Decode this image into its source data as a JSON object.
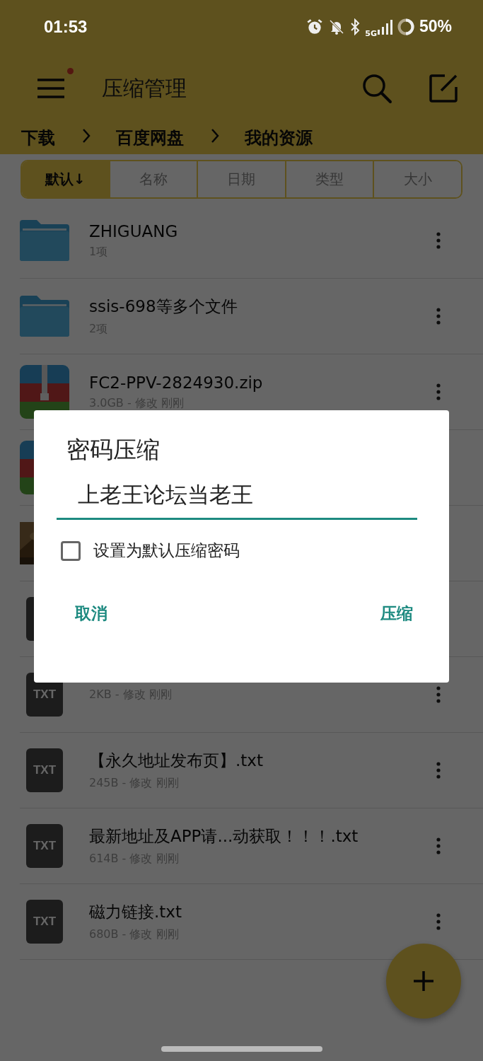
{
  "status_bar": {
    "time": "01:53",
    "network": "5G",
    "battery": "50%"
  },
  "toolbar": {
    "title": "压缩管理",
    "menu_badge": true
  },
  "breadcrumb": [
    "下载",
    "百度网盘",
    "我的资源"
  ],
  "sort_tabs": [
    {
      "label": "默认↓",
      "selected": true
    },
    {
      "label": "名称",
      "selected": false
    },
    {
      "label": "日期",
      "selected": false
    },
    {
      "label": "类型",
      "selected": false
    },
    {
      "label": "大小",
      "selected": false
    }
  ],
  "files": [
    {
      "kind": "folder",
      "name": "ZHIGUANG",
      "meta": "1项"
    },
    {
      "kind": "folder",
      "name": "ssis-698等多个文件",
      "meta": "2项"
    },
    {
      "kind": "zip",
      "name": "FC2-PPV-2824930.zip",
      "meta": "3.0GB - 修改 刚刚"
    },
    {
      "kind": "zip"
    },
    {
      "kind": "picture"
    },
    {
      "kind": "txt"
    },
    {
      "kind": "txt",
      "badge": "TXT",
      "meta": "2KB - 修改 刚刚"
    },
    {
      "kind": "txt",
      "badge": "TXT",
      "name": "【永久地址发布页】.txt",
      "meta": "245B - 修改 刚刚"
    },
    {
      "kind": "txt",
      "badge": "TXT",
      "name": "最新地址及APP请...动获取！！！.txt",
      "meta": "614B - 修改 刚刚"
    },
    {
      "kind": "txt",
      "badge": "TXT",
      "name": "磁力链接.txt",
      "meta": "680B - 修改 刚刚"
    }
  ],
  "dialog": {
    "title": "密码压缩",
    "password": "上老王论坛当老王",
    "checkbox": {
      "label": "设置为默认压缩密码",
      "checked": false
    },
    "buttons": [
      "取消",
      "压缩"
    ]
  }
}
